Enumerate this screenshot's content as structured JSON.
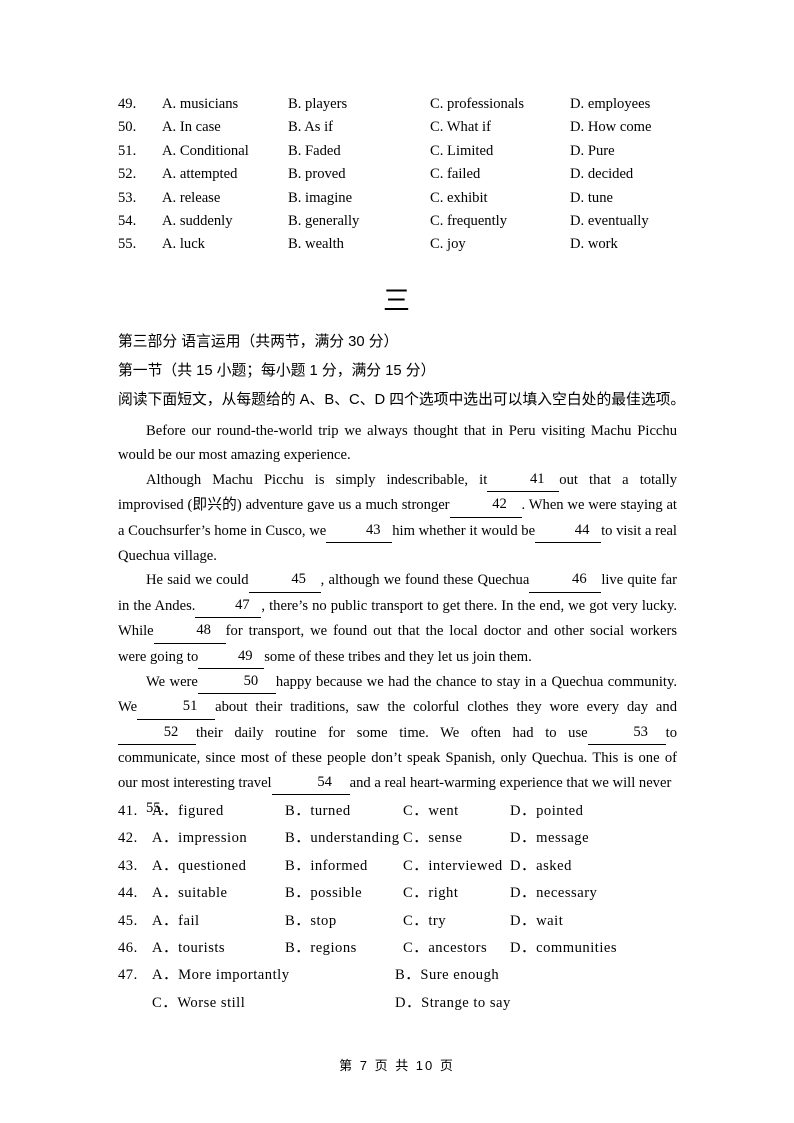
{
  "top_options": {
    "rows": [
      {
        "num": "49.",
        "a": "A. musicians",
        "b": "B. players",
        "c": "C. professionals",
        "d": "D. employees"
      },
      {
        "num": "50.",
        "a": "A. In case",
        "b": "B. As if",
        "c": "C. What if",
        "d": "D. How come"
      },
      {
        "num": "51.",
        "a": "A. Conditional",
        "b": "B. Faded",
        "c": "C. Limited",
        "d": "D. Pure"
      },
      {
        "num": "52.",
        "a": "A. attempted",
        "b": "B. proved",
        "c": "C. failed",
        "d": "D. decided"
      },
      {
        "num": "53.",
        "a": "A. release",
        "b": "B. imagine",
        "c": "C. exhibit",
        "d": "D. tune"
      },
      {
        "num": "54.",
        "a": "A. suddenly",
        "b": "B. generally",
        "c": "C. frequently",
        "d": "D. eventually"
      },
      {
        "num": "55.",
        "a": "A. luck",
        "b": "B. wealth",
        "c": "C. joy",
        "d": "D. work"
      }
    ]
  },
  "heading": "三",
  "chinese": {
    "part": "第三部分  语言运用（共两节，满分 30 分）",
    "section": "第一节（共 15 小题；每小题 1 分，满分 15 分）",
    "instruction": "阅读下面短文，从每题给的 A、B、C、D 四个选项中选出可以填入空白处的最佳选项。"
  },
  "passage": {
    "p1": "Before our round-the-world trip we always thought that in Peru visiting Machu Picchu would be our most amazing experience.",
    "p2_s1": "Although Machu Picchu is simply indescribable, it",
    "p2_s2": "out that a totally improvised (即兴的) adventure gave us a much stronger",
    "p2_s3": ". When we were staying at a Couchsurfer’s home in Cusco, we",
    "p2_s4": "him whether it would be",
    "p2_s5": "to visit a real Quechua village.",
    "p3_s1": "He said we could",
    "p3_s2": ", although we found these Quechua",
    "p3_s3": "live quite far in the Andes.",
    "p3_s4": ", there’s no public transport to get there. In the end, we got very lucky. While",
    "p3_s5": "for transport, we found out that the local doctor and other social workers were going to",
    "p3_s6": "some of these tribes and they let us join them.",
    "p4_s1": "We were",
    "p4_s2": "happy because we had the chance to stay in a Quechua community. We",
    "p4_s3": "about their traditions, saw the colorful clothes they wore every day and",
    "p4_s4": "their daily routine for some time. We often had to use",
    "p4_s5": "to communicate, since most of these people don’t speak Spanish, only Quechua. This is one of our most interesting travel",
    "p4_s6": "and a real heart-warming experience that we will never",
    "p4_s7": ".",
    "blanks": {
      "b41": "41",
      "b42": "42",
      "b43": "43",
      "b44": "44",
      "b45": "45",
      "b46": "46",
      "b47": "47",
      "b48": "48",
      "b49": "49",
      "b50": "50",
      "b51": "51",
      "b52": "52",
      "b53": "53",
      "b54": "54",
      "b55": "55"
    }
  },
  "bottom_options": {
    "rows": [
      {
        "num": "41.",
        "a": "A．figured",
        "b": "B．turned",
        "c": "C．went",
        "d": "D．pointed",
        "wide": false
      },
      {
        "num": "42.",
        "a": "A．impression",
        "b": "B．understanding",
        "c": "C．sense",
        "d": "D．message",
        "wide": false
      },
      {
        "num": "43.",
        "a": "A．questioned",
        "b": "B．informed",
        "c": "C．interviewed",
        "d": "D．asked",
        "wide": false
      },
      {
        "num": "44.",
        "a": "A．suitable",
        "b": "B．possible",
        "c": "C．right",
        "d": "D．necessary",
        "wide": false
      },
      {
        "num": "45.",
        "a": "A．fail",
        "b": "B．stop",
        "c": "C．try",
        "d": "D．wait",
        "wide": false
      },
      {
        "num": "46.",
        "a": "A．tourists",
        "b": "B．regions",
        "c": "C．ancestors",
        "d": "D．communities",
        "wide": false
      },
      {
        "num": "47.",
        "a": "A．More importantly",
        "b": "B．Sure enough",
        "c": "C．Worse still",
        "d": "D．Strange to say",
        "wide": true
      }
    ]
  },
  "footer": "第 7 页 共 10 页"
}
